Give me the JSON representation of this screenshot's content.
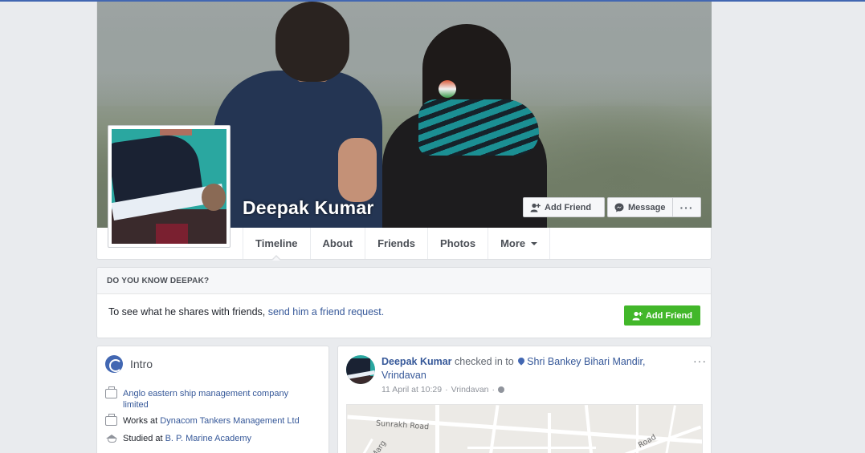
{
  "profile": {
    "name": "Deepak Kumar"
  },
  "cover_actions": {
    "add_friend": "Add Friend",
    "message": "Message",
    "more": "···"
  },
  "tabs": [
    {
      "label": "Timeline",
      "active": true
    },
    {
      "label": "About"
    },
    {
      "label": "Friends"
    },
    {
      "label": "Photos"
    },
    {
      "label": "More"
    }
  ],
  "know_card": {
    "heading": "DO YOU KNOW DEEPAK?",
    "text": "To see what he shares with friends, ",
    "link": "send him a friend request.",
    "button": "Add Friend"
  },
  "intro": {
    "title": "Intro",
    "items": [
      {
        "icon": "briefcase-icon",
        "prefix": "",
        "link": "Anglo eastern ship management company limited"
      },
      {
        "icon": "briefcase-icon",
        "prefix": "Works at ",
        "link": "Dynacom Tankers Management Ltd"
      },
      {
        "icon": "graduation-cap-icon",
        "prefix": "Studied at ",
        "link": "B. P. Marine Academy"
      }
    ]
  },
  "post": {
    "author": "Deepak Kumar",
    "action": " checked in to ",
    "place": "Shri Bankey Bihari Mandir, Vrindavan",
    "date": "11 April at 10:29",
    "separator": "·",
    "location": "Vrindavan",
    "privacy_separator": "·",
    "more": "···",
    "map_labels": [
      "Sunrakh Road",
      "Marg",
      "Road"
    ]
  },
  "colors": {
    "brand_blue": "#4267b2",
    "link_blue": "#365899",
    "green": "#42b72a",
    "background": "#e9ebee"
  }
}
